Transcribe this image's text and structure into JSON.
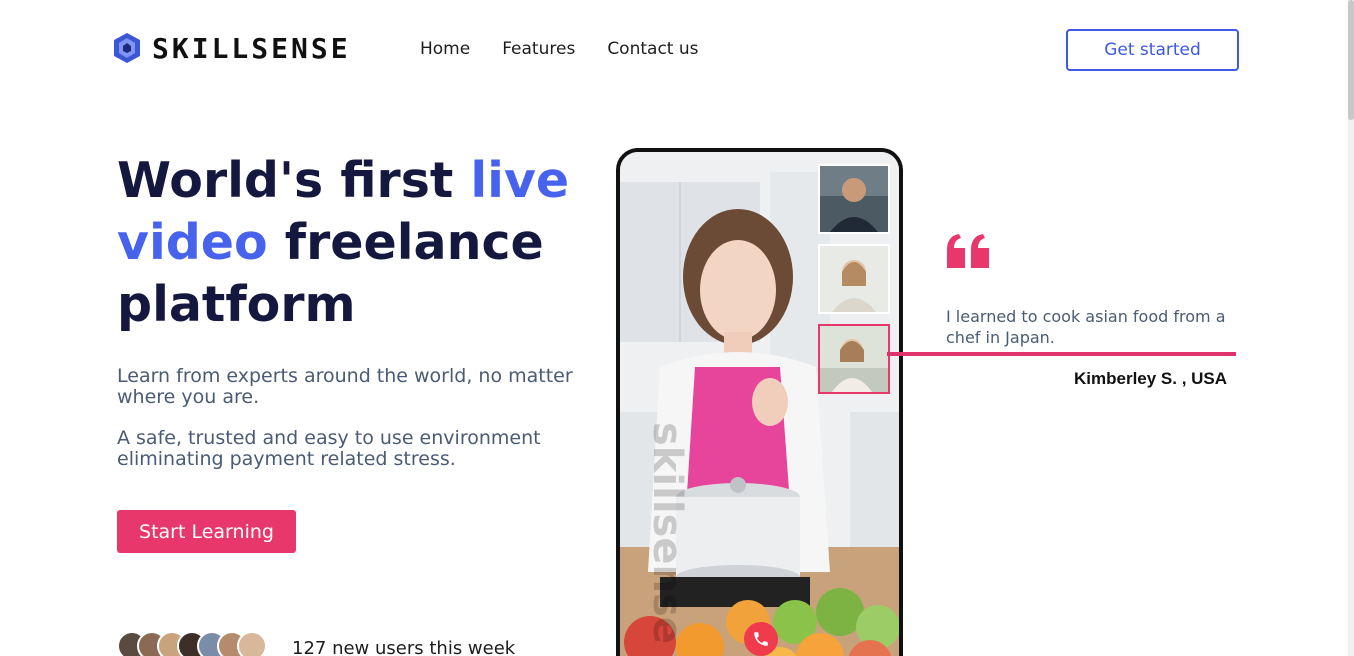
{
  "header": {
    "logo_text": "SKILLSENSE",
    "nav": [
      "Home",
      "Features",
      "Contact us"
    ],
    "cta": "Get started"
  },
  "hero": {
    "title_part1": "World's first ",
    "title_highlight1": "live",
    "title_highlight2": "video",
    "title_part2": " freelance platform",
    "paragraph1": "Learn from experts around the world, no matter where you are.",
    "paragraph2": "A safe, trusted and easy to use environment eliminating payment related stress.",
    "button": "Start Learning",
    "users_text": "127 new users this week"
  },
  "phone": {
    "watermark": "skillsense",
    "call_icon": "phone-call-icon"
  },
  "testimonial": {
    "quote": "I learned to cook asian food from a chef in Japan.",
    "author": "Kimberley S. , USA"
  },
  "colors": {
    "accent_blue": "#4763ee",
    "accent_pink": "#e8376a",
    "navy": "#14183e"
  }
}
